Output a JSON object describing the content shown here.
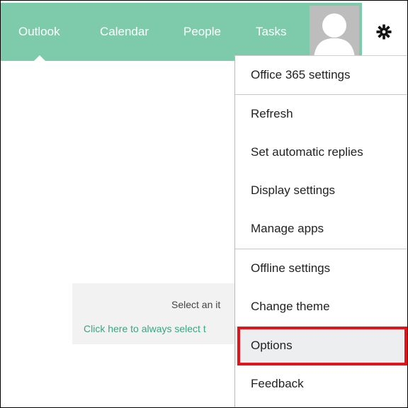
{
  "nav": {
    "tabs": [
      {
        "label": "Outlook"
      },
      {
        "label": "Calendar"
      },
      {
        "label": "People"
      },
      {
        "label": "Tasks"
      }
    ],
    "active_tab": "Outlook"
  },
  "colors": {
    "nav_green": "#7ecbab",
    "highlight_red": "#e2141b",
    "link_green": "#3aa57f"
  },
  "icons": {
    "settings": "gear-icon",
    "user": "avatar-icon"
  },
  "reading_pane": {
    "line1": "Select an it",
    "line2": "Click here to always select t"
  },
  "settings_menu": {
    "items": [
      {
        "label": "Office 365 settings"
      },
      {
        "label": "Refresh"
      },
      {
        "label": "Set automatic replies"
      },
      {
        "label": "Display settings"
      },
      {
        "label": "Manage apps"
      },
      {
        "label": "Offline settings"
      },
      {
        "label": "Change theme"
      },
      {
        "label": "Options"
      },
      {
        "label": "Feedback"
      }
    ],
    "highlighted": "Options"
  }
}
